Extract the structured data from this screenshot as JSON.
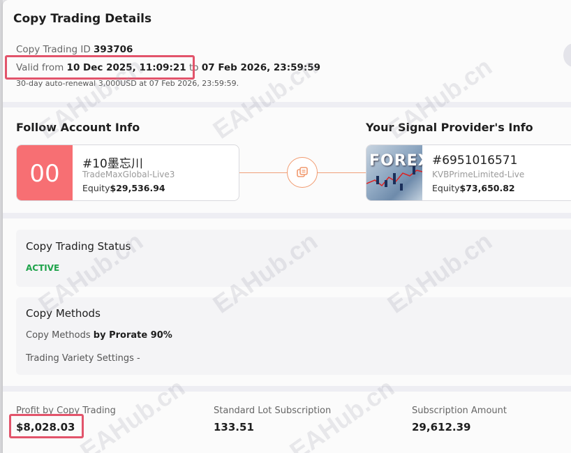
{
  "dialog": {
    "title": "Copy Trading Details",
    "copy_id_label": "Copy Trading ID",
    "copy_id_value": "393706",
    "valid_from_label": "Valid from",
    "valid_from_value": "10 Dec 2025, 11:09:21",
    "valid_to_label": "to",
    "valid_to_value": "07 Feb 2026, 23:59:59",
    "renewal_note": "30-day auto-renewal 3,000USD at 07 Feb 2026, 23:59:59."
  },
  "follow_account": {
    "heading": "Follow Account Info",
    "avatar_text": "00",
    "name": "#10墨忘川",
    "server": "TradeMaxGlobal-Live3",
    "equity_label": "Equity",
    "equity_value": "$29,536.94"
  },
  "provider_account": {
    "heading": "Your Signal Provider's Info",
    "avatar_text": "FOREX",
    "name": "#6951016571",
    "server": "KVBPrimeLimited-Live",
    "equity_label": "Equity",
    "equity_value": "$73,650.82"
  },
  "status_box": {
    "title": "Copy Trading Status",
    "status": "ACTIVE"
  },
  "methods_box": {
    "title": "Copy Methods",
    "method_label": "Copy Methods",
    "method_value": "by Prorate 90%",
    "variety_label": "Trading Variety Settings",
    "variety_value": "-"
  },
  "stats": {
    "profit_label": "Profit by Copy Trading",
    "profit_value": "$8,028.03",
    "lot_label": "Standard Lot Subscription",
    "lot_value": "133.51",
    "amount_label": "Subscription Amount",
    "amount_value": "29,612.39"
  },
  "watermark_text": "EAHub.cn",
  "colors": {
    "accent_orange": "#f19a6f",
    "avatar_red": "#f76f73",
    "active_green": "#1ea34a",
    "highlight_red": "#e2546b"
  }
}
